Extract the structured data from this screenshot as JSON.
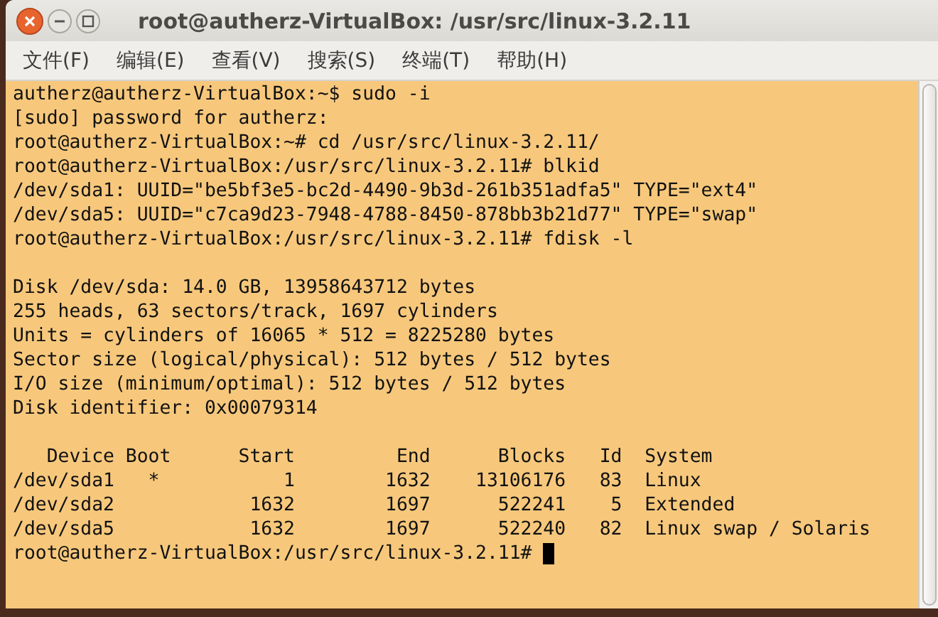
{
  "window": {
    "title": "root@autherz-VirtualBox: /usr/src/linux-3.2.11"
  },
  "menu": [
    "文件(F)",
    "编辑(E)",
    "查看(V)",
    "搜索(S)",
    "终端(T)",
    "帮助(H)"
  ],
  "terminal": {
    "cursor": true,
    "blocks": [
      [
        "autherz@autherz-VirtualBox:~$ sudo -i",
        "[sudo] password for autherz:",
        "root@autherz-VirtualBox:~# cd /usr/src/linux-3.2.11/",
        "root@autherz-VirtualBox:/usr/src/linux-3.2.11# blkid",
        "/dev/sda1: UUID=\"be5bf3e5-bc2d-4490-9b3d-261b351adfa5\" TYPE=\"ext4\"",
        "/dev/sda5: UUID=\"c7ca9d23-7948-4788-8450-878bb3b21d77\" TYPE=\"swap\"",
        "root@autherz-VirtualBox:/usr/src/linux-3.2.11# fdisk -l"
      ],
      [
        "Disk /dev/sda: 14.0 GB, 13958643712 bytes",
        "255 heads, 63 sectors/track, 1697 cylinders",
        "Units = cylinders of 16065 * 512 = 8225280 bytes",
        "Sector size (logical/physical): 512 bytes / 512 bytes",
        "I/O size (minimum/optimal): 512 bytes / 512 bytes",
        "Disk identifier: 0x00079314"
      ],
      [
        "   Device Boot      Start         End      Blocks   Id  System",
        "/dev/sda1   *           1        1632    13106176   83  Linux",
        "/dev/sda2            1632        1697      522241    5  Extended",
        "/dev/sda5            1632        1697      522240   82  Linux swap / Solaris",
        "root@autherz-VirtualBox:/usr/src/linux-3.2.11# "
      ]
    ]
  }
}
